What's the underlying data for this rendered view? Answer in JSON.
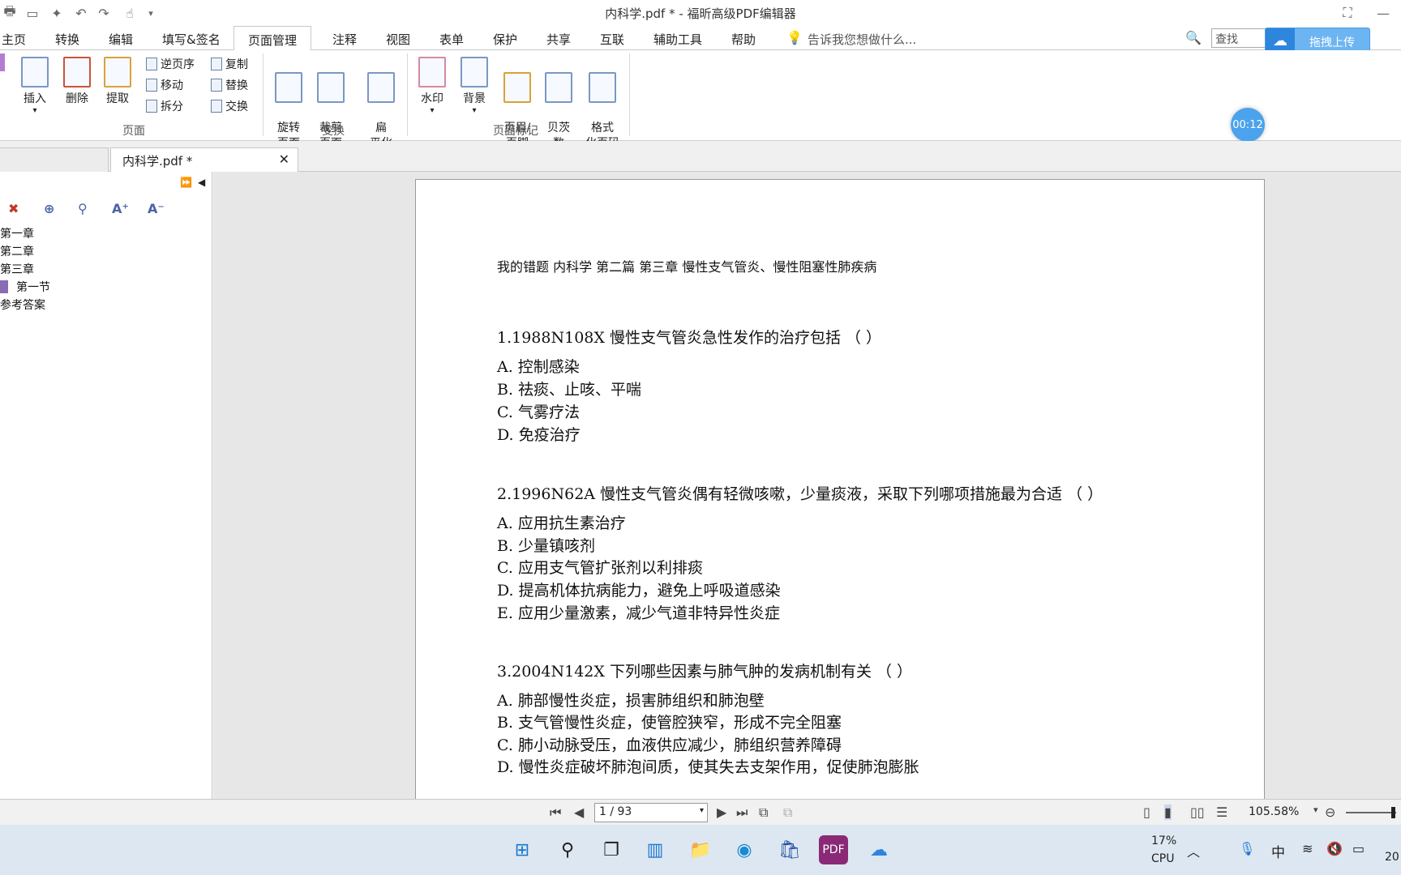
{
  "window": {
    "title": "内科学.pdf * - 福昕高级PDF编辑器"
  },
  "menu": [
    "主页",
    "转换",
    "编辑",
    "填写&签名",
    "页面管理",
    "注释",
    "视图",
    "表单",
    "保护",
    "共享",
    "互联",
    "辅助工具",
    "帮助"
  ],
  "tell_me": "告诉我您想做什么...",
  "search_placeholder": "查找",
  "upload_label": "拖拽上传",
  "timer": "00:12",
  "ribbon": {
    "insert": "插入",
    "delete": "删除",
    "extract": "提取",
    "reverse": "逆页序",
    "move": "移动",
    "split": "拆分",
    "copy": "复制",
    "replace": "替换",
    "swap": "交换",
    "rotate": "旋转\n页面",
    "crop": "裁剪\n页面",
    "flatten": "扁\n平化",
    "watermark": "水印",
    "background": "背景",
    "header_footer": "页眉/\n页脚",
    "bates": "贝茨\n数",
    "format_page_num": "格式\n化页码",
    "group_pages": "页面",
    "group_transform": "变换",
    "group_page_marks": "页面标记"
  },
  "tab": {
    "label": "内科学.pdf *"
  },
  "bookmarks": [
    "第一章",
    "第二章",
    "第三章",
    "第一节",
    "参考答案"
  ],
  "document": {
    "header": "我的错题 内科学 第二篇 第三章 慢性支气管炎、慢性阻塞性肺疾病",
    "q1": {
      "title": "1.1988N108X 慢性支气管炎急性发作的治疗包括 （ ）",
      "options": [
        "A. 控制感染",
        "B. 祛痰、止咳、平喘",
        "C. 气雾疗法",
        "D. 免疫治疗"
      ]
    },
    "q2": {
      "title": "2.1996N62A 慢性支气管炎偶有轻微咳嗽，少量痰液，采取下列哪项措施最为合适 （ ）",
      "options": [
        "A. 应用抗生素治疗",
        "B. 少量镇咳剂",
        "C. 应用支气管扩张剂以利排痰",
        "D. 提高机体抗病能力，避免上呼吸道感染",
        "E. 应用少量激素，减少气道非特异性炎症"
      ]
    },
    "q3": {
      "title": "3.2004N142X 下列哪些因素与肺气肿的发病机制有关 （ ）",
      "options": [
        "A. 肺部慢性炎症，损害肺组织和肺泡壁",
        "B. 支气管慢性炎症，使管腔狭窄，形成不完全阻塞",
        "C. 肺小动脉受压，血液供应减少，肺组织营养障碍",
        "D. 慢性炎症破坏肺泡间质，使其失去支架作用，促使肺泡膨胀"
      ]
    }
  },
  "status": {
    "page": "1 / 93",
    "zoom": "105.58%"
  },
  "taskbar": {
    "cpu_pct": "17%",
    "cpu_label": "CPU",
    "ime": "中",
    "clock_partial": "20"
  },
  "colors": {
    "accent": "#2d86dc",
    "ribbon_border": "#c9c9c9",
    "page_bg": "#e7e7e7"
  }
}
